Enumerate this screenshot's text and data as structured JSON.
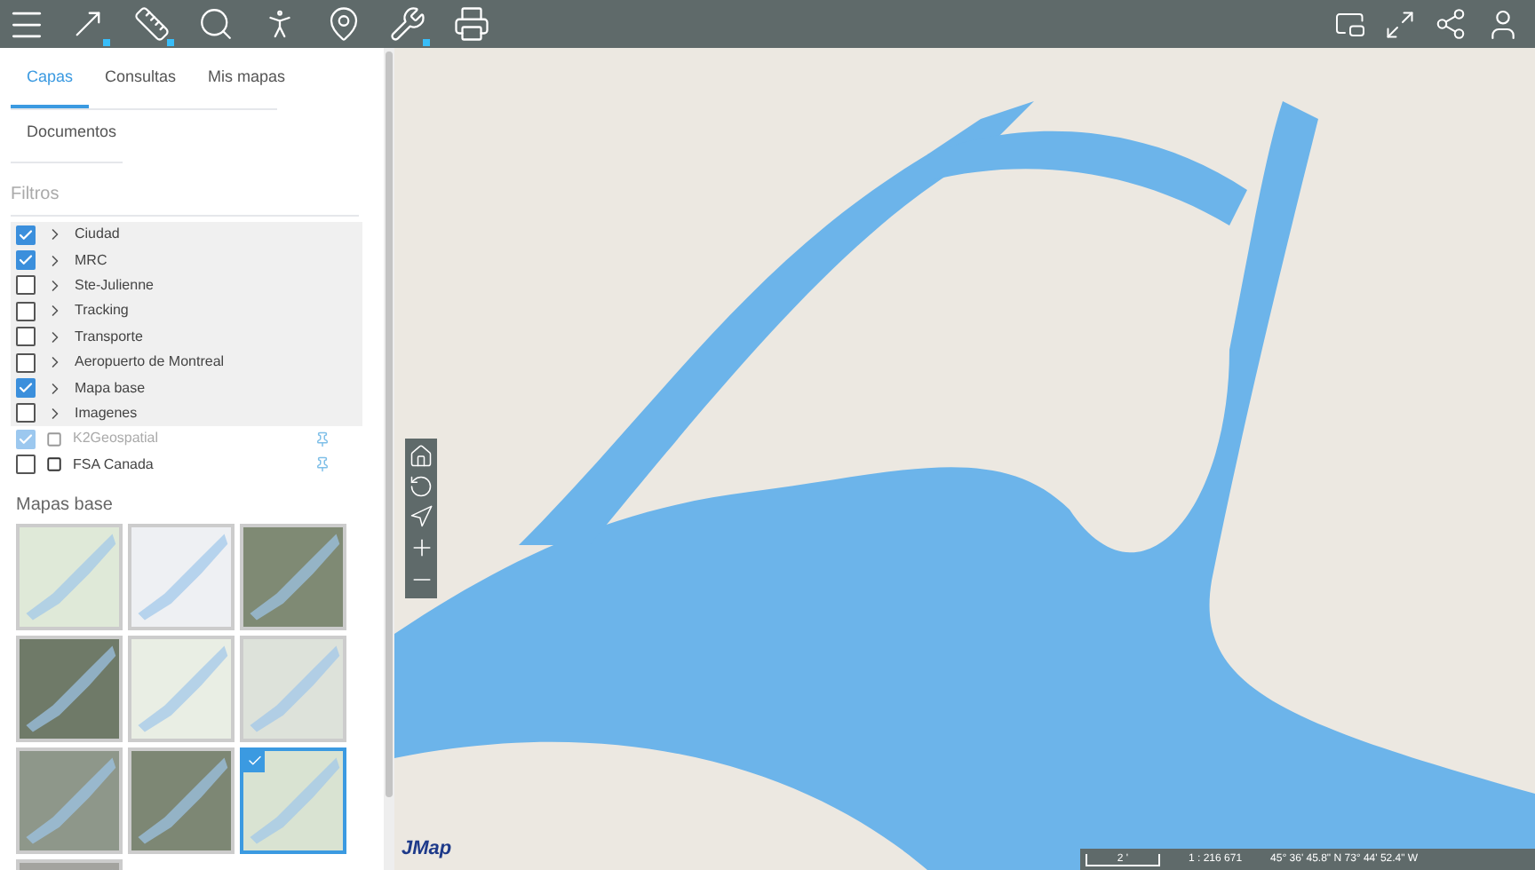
{
  "tabs": [
    {
      "label": "Capas",
      "selected": true
    },
    {
      "label": "Consultas",
      "selected": false
    },
    {
      "label": "Mis mapas",
      "selected": false
    },
    {
      "label": "Documentos",
      "selected": false
    }
  ],
  "filter": {
    "placeholder": "Filtros"
  },
  "layers": [
    {
      "label": "Ciudad",
      "checked": true,
      "kind": "group",
      "disabled": false
    },
    {
      "label": "MRC",
      "checked": true,
      "kind": "group",
      "disabled": false
    },
    {
      "label": "Ste-Julienne",
      "checked": false,
      "kind": "group",
      "disabled": false
    },
    {
      "label": "Tracking",
      "checked": false,
      "kind": "group",
      "disabled": false
    },
    {
      "label": "Transporte",
      "checked": false,
      "kind": "group",
      "disabled": false
    },
    {
      "label": "Aeropuerto de Montreal",
      "checked": false,
      "kind": "group",
      "disabled": false
    },
    {
      "label": "Mapa base",
      "checked": true,
      "kind": "group",
      "disabled": false
    },
    {
      "label": "Imagenes",
      "checked": false,
      "kind": "group",
      "disabled": false
    },
    {
      "label": "K2Geospatial",
      "checked": true,
      "kind": "layer",
      "disabled": true
    },
    {
      "label": "FSA Canada",
      "checked": false,
      "kind": "layer",
      "disabled": false
    }
  ],
  "basemaps": {
    "title": "Mapas base",
    "items": [
      {
        "selected": false,
        "color": "#dfe9d8"
      },
      {
        "selected": false,
        "color": "#eef0f3"
      },
      {
        "selected": false,
        "color": "#7f8a74"
      },
      {
        "selected": false,
        "color": "#6f7a68"
      },
      {
        "selected": false,
        "color": "#e9eee4"
      },
      {
        "selected": false,
        "color": "#dde2da"
      },
      {
        "selected": false,
        "color": "#8e978a"
      },
      {
        "selected": false,
        "color": "#7d8774"
      },
      {
        "selected": true,
        "color": "#d9e3d2"
      },
      {
        "selected": false,
        "color": "#a3a39f"
      }
    ]
  },
  "map": {
    "logo": "JMap",
    "scale_bar": "2 '",
    "scale": "1 : 216 671",
    "coordinates": "45° 36' 45.8\" N 73° 44' 52.4\" W"
  }
}
